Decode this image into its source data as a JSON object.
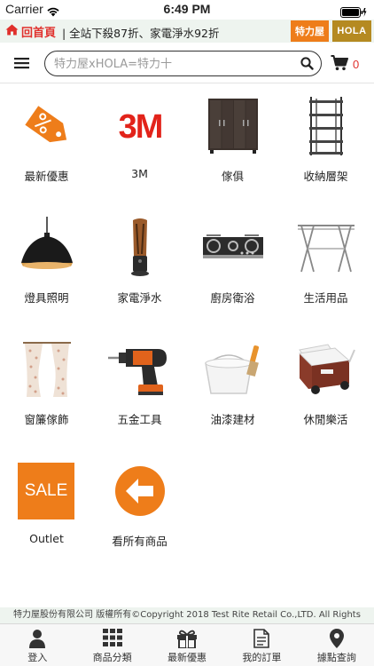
{
  "status_bar": {
    "carrier": "Carrier",
    "time": "6:49 PM"
  },
  "banner": {
    "home_label": "回首頁",
    "promo_text": "| 全站下殺87折、家電淨水92折",
    "logo_trl": "特力屋",
    "logo_hola": "HOLA"
  },
  "header": {
    "search_placeholder": "特力屋xHOLA=特力十",
    "cart_count": "0"
  },
  "categories": [
    {
      "label": "最新優惠",
      "icon": "discount-tag-icon"
    },
    {
      "label": "3M",
      "icon": "3m-logo-icon"
    },
    {
      "label": "傢俱",
      "icon": "cabinet-icon"
    },
    {
      "label": "收納層架",
      "icon": "shelf-rack-icon"
    },
    {
      "label": "燈具照明",
      "icon": "pendant-lamp-icon"
    },
    {
      "label": "家電淨水",
      "icon": "tower-fan-icon"
    },
    {
      "label": "廚房衛浴",
      "icon": "gas-stove-icon"
    },
    {
      "label": "生活用品",
      "icon": "drying-rack-icon"
    },
    {
      "label": "窗簾傢飾",
      "icon": "curtain-icon"
    },
    {
      "label": "五金工具",
      "icon": "power-drill-icon"
    },
    {
      "label": "油漆建材",
      "icon": "paint-bucket-icon"
    },
    {
      "label": "休閒樂活",
      "icon": "cooler-box-icon"
    },
    {
      "label": "Outlet",
      "icon": "sale-badge-icon",
      "badge_text": "SALE"
    },
    {
      "label": "看所有商品",
      "icon": "arrow-left-circle-icon"
    }
  ],
  "footer": {
    "copyright": "特力屋股份有限公司 版權所有©Copyright 2018 Test Rite Retail Co.,LTD. All Rights"
  },
  "tabbar": [
    {
      "label": "登入",
      "icon": "user-icon"
    },
    {
      "label": "商品分類",
      "icon": "grid-icon"
    },
    {
      "label": "最新優惠",
      "icon": "gift-icon"
    },
    {
      "label": "我的訂單",
      "icon": "document-icon"
    },
    {
      "label": "據點查詢",
      "icon": "location-pin-icon"
    }
  ],
  "colors": {
    "brand_orange": "#ee7d1a",
    "hola_gold": "#b58a21",
    "accent_red": "#e0302c",
    "banner_bg": "#eef4ef"
  }
}
